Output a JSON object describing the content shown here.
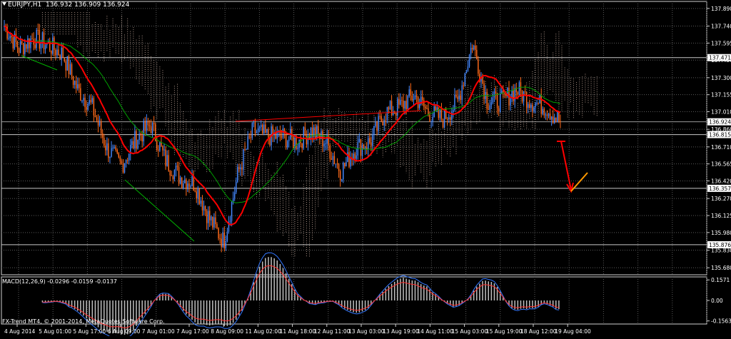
{
  "window": {
    "symbol_header": "EURJPY,H1  136.932 136.909 136.924",
    "copyright": "FX-Trend MT4, © 2001-2014, MetaQuotes Software Corp."
  },
  "chart_data": [
    {
      "type": "line",
      "name": "price",
      "y_ticks": [
        137.89,
        137.74,
        137.595,
        137.45,
        137.3,
        137.155,
        137.01,
        136.86,
        136.71,
        136.565,
        136.42,
        136.27,
        136.125,
        135.98,
        135.83,
        135.68
      ],
      "ylim": [
        135.62,
        137.95
      ],
      "horizontal_levels": [
        137.471,
        136.815,
        136.357,
        135.876
      ],
      "current_price": 136.924,
      "x_labels": [
        "4 Aug 2014",
        "5 Aug 01:00",
        "5 Aug 17:00",
        "6 Aug 09:00",
        "7 Aug 01:00",
        "7 Aug 17:00",
        "8 Aug 09:00",
        "11 Aug 02:00",
        "11 Aug 18:00",
        "12 Aug 11:00",
        "13 Aug 03:00",
        "13 Aug 19:00",
        "14 Aug 11:00",
        "15 Aug 03:00",
        "15 Aug 19:00",
        "18 Aug 12:00",
        "19 Aug 04:00"
      ],
      "approx_close_path": [
        137.74,
        137.55,
        137.64,
        137.58,
        137.5,
        137.2,
        137.05,
        136.7,
        136.55,
        136.78,
        136.9,
        136.6,
        136.45,
        136.4,
        136.1,
        135.9,
        136.5,
        136.85,
        136.8,
        136.8,
        136.75,
        136.85,
        136.75,
        136.5,
        136.7,
        136.75,
        137.0,
        137.05,
        137.15,
        137.0,
        136.95,
        137.1,
        137.6,
        137.1,
        137.1,
        137.2,
        137.1,
        137.05,
        136.924
      ],
      "colors": {
        "up": "#4488ff",
        "down": "#ff6a1a",
        "ma_fast": "#ff0000",
        "ma_slow": "#00a000",
        "cloud": "#e8c8b8"
      }
    },
    {
      "type": "bar",
      "name": "MACD(12,26,9) -0.0296 -0.0159 -0.0137",
      "y_ticks": [
        0.1571,
        0.0,
        -0.1563
      ],
      "ylim": [
        -0.18,
        0.18
      ]
    }
  ]
}
